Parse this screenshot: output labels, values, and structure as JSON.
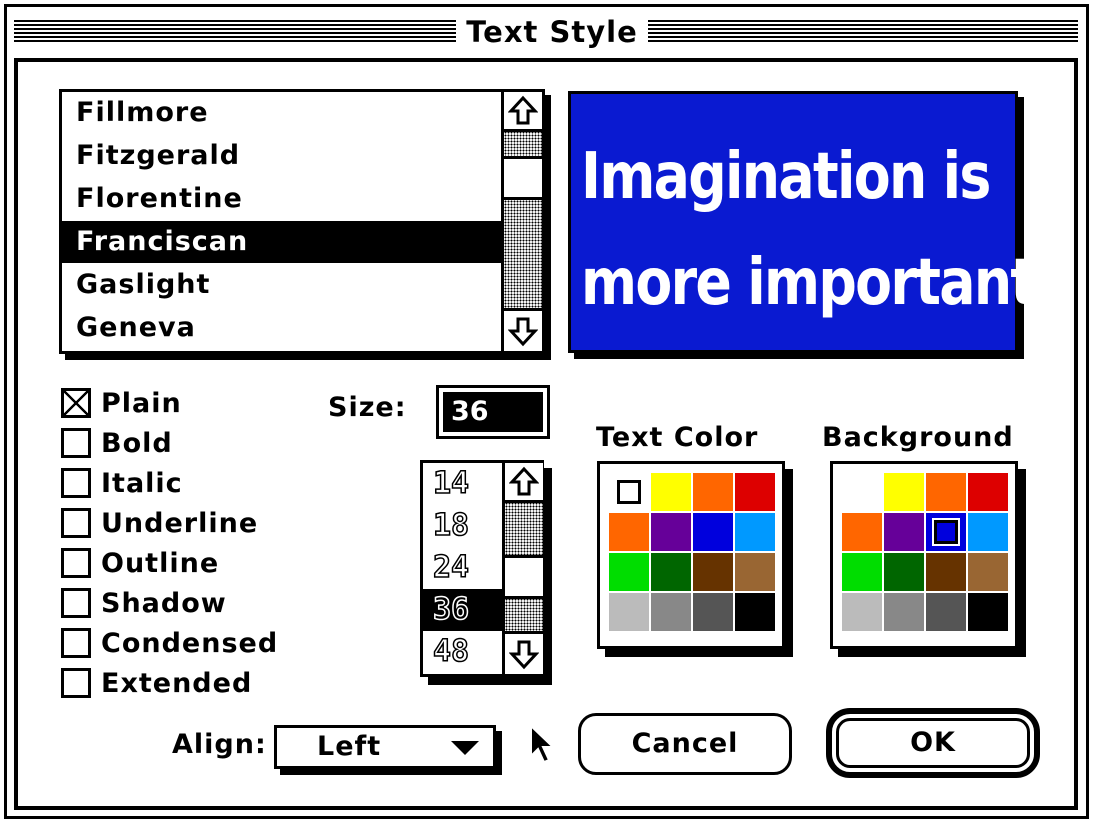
{
  "dialog": {
    "title": "Text Style"
  },
  "font_list": {
    "items": [
      "Fillmore",
      "Fitzgerald",
      "Florentine",
      "Franciscan",
      "Gaslight",
      "Geneva"
    ],
    "selected": "Franciscan"
  },
  "preview": {
    "line1": "Imagination is",
    "line2": "more important",
    "background_color": "#0a1ad1",
    "text_color": "#ffffff"
  },
  "styles": [
    {
      "label": "Plain",
      "checked": true
    },
    {
      "label": "Bold",
      "checked": false
    },
    {
      "label": "Italic",
      "checked": false
    },
    {
      "label": "Underline",
      "checked": false
    },
    {
      "label": "Outline",
      "checked": false
    },
    {
      "label": "Shadow",
      "checked": false
    },
    {
      "label": "Condensed",
      "checked": false
    },
    {
      "label": "Extended",
      "checked": false
    }
  ],
  "size": {
    "label": "Size:",
    "value": "36",
    "options": [
      "14",
      "18",
      "24",
      "36",
      "48"
    ],
    "selected": "36"
  },
  "text_color": {
    "label": "Text Color",
    "colors": [
      "#ffffff",
      "#ffff00",
      "#ff6600",
      "#dd0000",
      "#ff6600",
      "#660099",
      "#0000dd",
      "#0099ff",
      "#00dd00",
      "#006600",
      "#663300",
      "#996633",
      "#bbbbbb",
      "#888888",
      "#555555",
      "#000000"
    ],
    "selected_index": 0
  },
  "background_color": {
    "label": "Background",
    "colors": [
      "#ffffff",
      "#ffff00",
      "#ff6600",
      "#dd0000",
      "#ff6600",
      "#660099",
      "#0000dd",
      "#0099ff",
      "#00dd00",
      "#006600",
      "#663300",
      "#996633",
      "#bbbbbb",
      "#888888",
      "#555555",
      "#000000"
    ],
    "selected_index": 6
  },
  "align": {
    "label": "Align:",
    "value": "Left"
  },
  "buttons": {
    "cancel": "Cancel",
    "ok": "OK"
  },
  "icons": {
    "scroll_up": "up-arrow-icon",
    "scroll_down": "down-arrow-icon",
    "dropdown": "triangle-down-icon",
    "cursor": "arrow-pointer-icon"
  }
}
